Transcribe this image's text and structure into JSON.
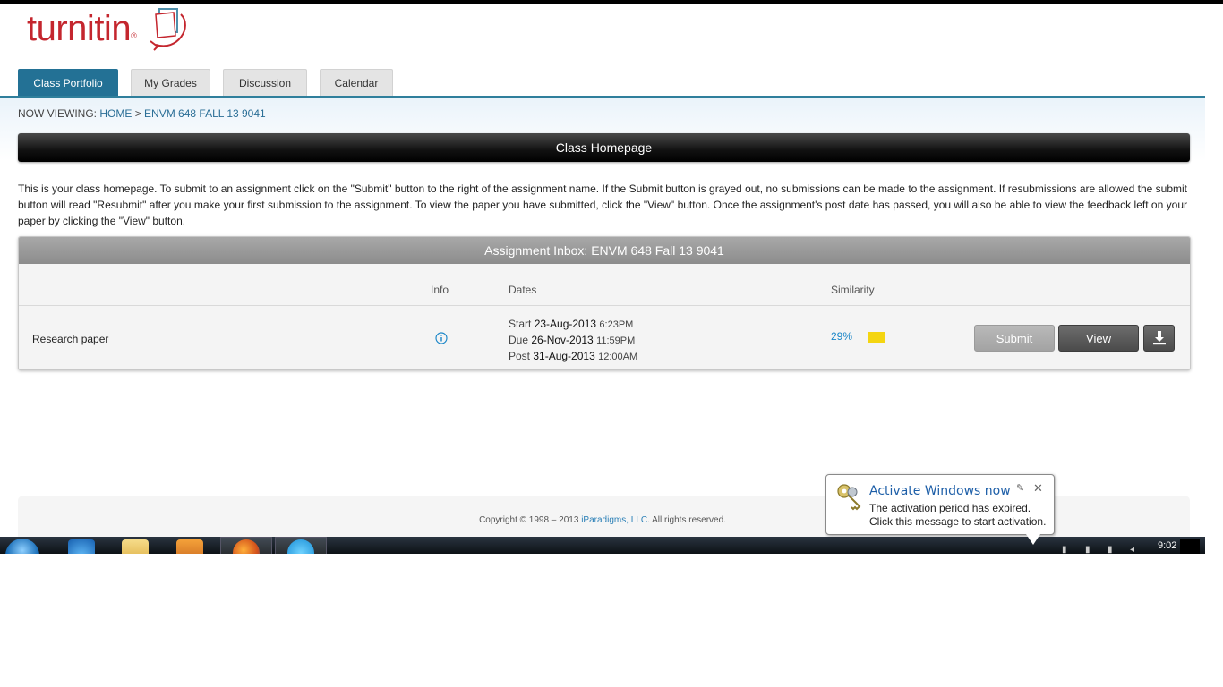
{
  "logo": {
    "text": "turnitin",
    "mark": "®"
  },
  "tabs": [
    {
      "label": "Class Portfolio",
      "active": true
    },
    {
      "label": "My Grades",
      "active": false
    },
    {
      "label": "Discussion",
      "active": false
    },
    {
      "label": "Calendar",
      "active": false
    }
  ],
  "breadcrumb": {
    "prefix": "NOW VIEWING:",
    "home": "HOME",
    "separator": ">",
    "current": "ENVM 648 FALL 13 9041"
  },
  "class_bar": {
    "title": "Class Homepage"
  },
  "intro": "This is your class homepage. To submit to an assignment click on the \"Submit\" button to the right of the assignment name. If the Submit button is grayed out, no submissions can be made to the assignment. If resubmissions are allowed the submit button will read \"Resubmit\" after you make your first submission to the assignment. To view the paper you have submitted, click the \"View\" button. Once the assignment's post date has passed, you will also be able to view the feedback left on your paper by clicking the \"View\" button.",
  "inbox": {
    "title": "Assignment Inbox: ENVM 648 Fall 13 9041",
    "columns": {
      "info": "Info",
      "dates": "Dates",
      "similarity": "Similarity"
    },
    "rows": [
      {
        "title": "Research paper",
        "dates": [
          {
            "label": "Start",
            "date": "23-Aug-2013",
            "time": "6:23PM"
          },
          {
            "label": "Due",
            "date": "26-Nov-2013",
            "time": "11:59PM"
          },
          {
            "label": "Post",
            "date": "31-Aug-2013",
            "time": "12:00AM"
          }
        ],
        "similarity": "29%",
        "submit_label": "Submit",
        "view_label": "View"
      }
    ]
  },
  "footer": {
    "copyright_pre": "Copyright © 1998 – 2013",
    "company": "iParadigms, LLC",
    "copyright_post": ". All rights reserved."
  },
  "balloon": {
    "title": "Activate Windows now",
    "line1": "The activation period has expired.",
    "line2": "Click this message to start activation."
  },
  "taskbar": {
    "clock": "9:02"
  },
  "colors": {
    "accent": "#237195",
    "brand": "#c4262e",
    "link": "#2a6e96",
    "similarity_bar": "#f4d511"
  }
}
